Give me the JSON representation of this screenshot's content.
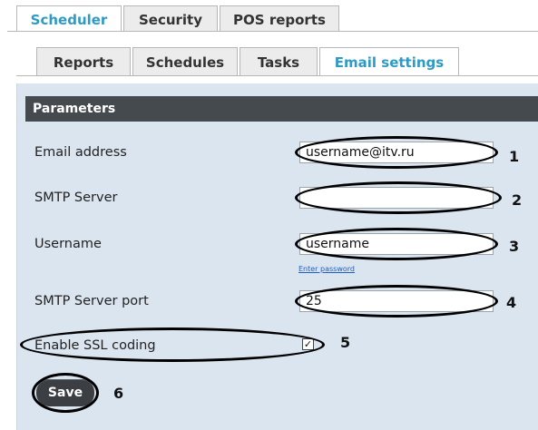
{
  "tabs": {
    "scheduler": "Scheduler",
    "security": "Security",
    "pos_reports": "POS reports"
  },
  "subtabs": {
    "reports": "Reports",
    "schedules": "Schedules",
    "tasks": "Tasks",
    "email_settings": "Email settings"
  },
  "panel": {
    "title": "Parameters"
  },
  "form": {
    "email_label": "Email address",
    "email_value": "username@itv.ru",
    "smtp_label": "SMTP Server",
    "smtp_value": "",
    "username_label": "Username",
    "username_value": "username",
    "enter_password": "Enter password",
    "port_label": "SMTP Server port",
    "port_value": "25",
    "ssl_label": "Enable SSL coding",
    "ssl_checked": "✓",
    "save_label": "Save"
  },
  "callouts": {
    "n1": "1",
    "n2": "2",
    "n3": "3",
    "n4": "4",
    "n5": "5",
    "n6": "6"
  },
  "colors": {
    "active_tab_text": "#2e9bc5",
    "panel_bg": "#dbe5ef",
    "header_bg": "#454a4f"
  }
}
